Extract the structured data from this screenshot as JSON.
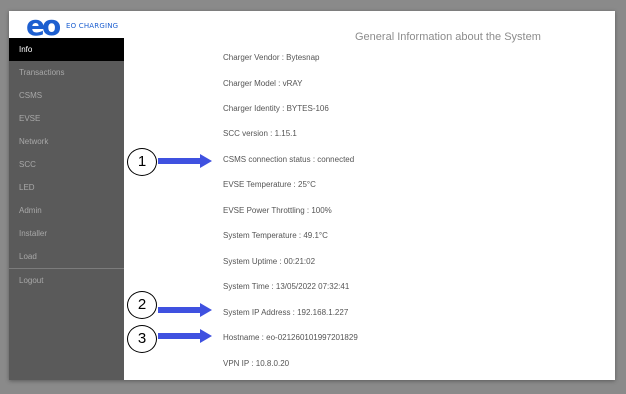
{
  "brand": {
    "logo_mark": "eo",
    "logo_text": "EO CHARGING",
    "accent_color": "#1d5fd0"
  },
  "sidebar": {
    "items": [
      {
        "label": "Info",
        "active": true
      },
      {
        "label": "Transactions"
      },
      {
        "label": "CSMS"
      },
      {
        "label": "EVSE"
      },
      {
        "label": "Network"
      },
      {
        "label": "SCC"
      },
      {
        "label": "LED"
      },
      {
        "label": "Admin"
      },
      {
        "label": "Installer"
      },
      {
        "label": "Load"
      },
      {
        "label": "Logout"
      }
    ]
  },
  "main": {
    "title": "General Information about the System",
    "lines": [
      "Charger Vendor : Bytesnap",
      "Charger Model : vRAY",
      "Charger Identity : BYTES-106",
      "SCC version : 1.15.1",
      "CSMS connection status : connected",
      "EVSE Temperature : 25°C",
      "EVSE Power Throttling : 100%",
      "System Temperature : 49.1°C",
      "System Uptime : 00:21:02",
      "System Time : 13/05/2022 07:32:41",
      "System IP Address : 192.168.1.227",
      "Hostname : eo-021260101997201829",
      "VPN IP : 10.8.0.20"
    ]
  },
  "callouts": {
    "c1": "1",
    "c2": "2",
    "c3": "3",
    "arrow_color": "#3f51e0"
  }
}
